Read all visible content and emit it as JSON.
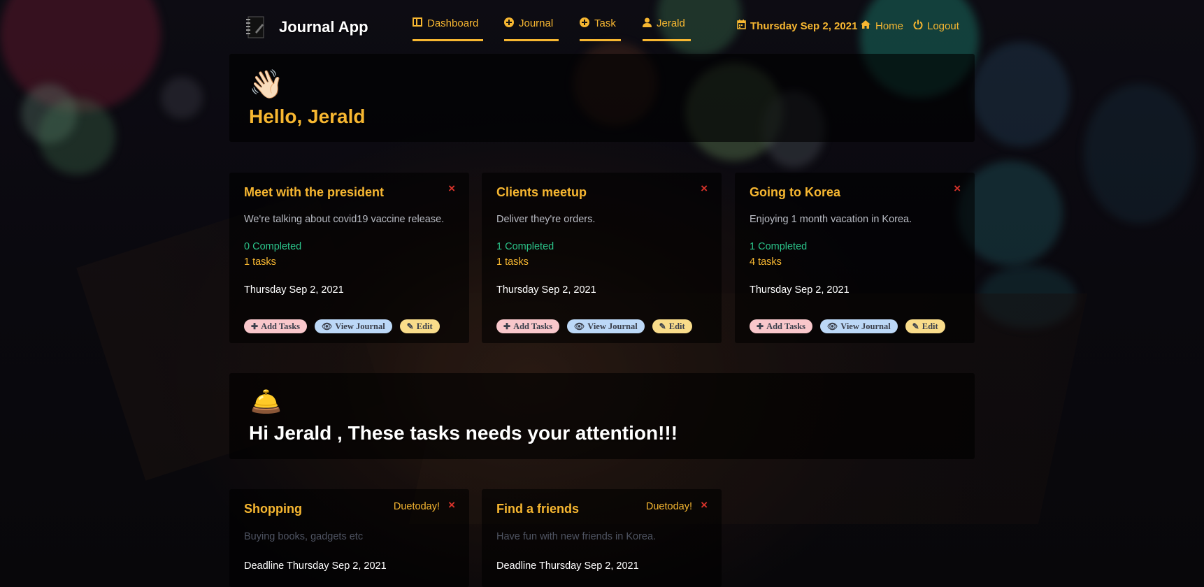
{
  "nav": {
    "brand": "Journal App",
    "links": [
      {
        "label": "Dashboard",
        "icon": "dashboard-icon"
      },
      {
        "label": "Journal",
        "icon": "plus-circle-icon"
      },
      {
        "label": "Task",
        "icon": "plus-circle-icon"
      },
      {
        "label": "Jerald",
        "icon": "user-icon"
      }
    ],
    "date": "Thursday Sep 2, 2021",
    "home": "Home",
    "logout": "Logout",
    "accent": "#f7b731"
  },
  "greeting": {
    "emoji": "👋🏻",
    "text": "Hello, Jerald"
  },
  "journals": [
    {
      "title": "Meet with the president",
      "description": "We're talking about covid19 vaccine release.",
      "completed": "0 Completed",
      "tasks": "1 tasks",
      "date": "Thursday Sep 2, 2021",
      "close": "×"
    },
    {
      "title": "Clients meetup",
      "description": "Deliver they're orders.",
      "completed": "1 Completed",
      "tasks": "1 tasks",
      "date": "Thursday Sep 2, 2021",
      "close": "×"
    },
    {
      "title": "Going to Korea",
      "description": "Enjoying 1 month vacation in Korea.",
      "completed": "1 Completed",
      "tasks": "4 tasks",
      "date": "Thursday Sep 2, 2021",
      "close": "×"
    }
  ],
  "card_buttons": {
    "add": "Add Tasks",
    "view": "View Journal",
    "edit": "Edit"
  },
  "attention": {
    "emoji": "🛎️",
    "text": "Hi Jerald , These tasks needs your attention!!!"
  },
  "due_tasks": [
    {
      "title": "Shopping",
      "due": "Duetoday!",
      "description": "Buying books, gadgets etc",
      "deadline": "Deadline Thursday Sep 2, 2021",
      "close": "×"
    },
    {
      "title": "Find a friends",
      "due": "Duetoday!",
      "description": "Have fun with new friends in Korea.",
      "deadline": "Deadline Thursday Sep 2, 2021",
      "close": "×"
    }
  ]
}
